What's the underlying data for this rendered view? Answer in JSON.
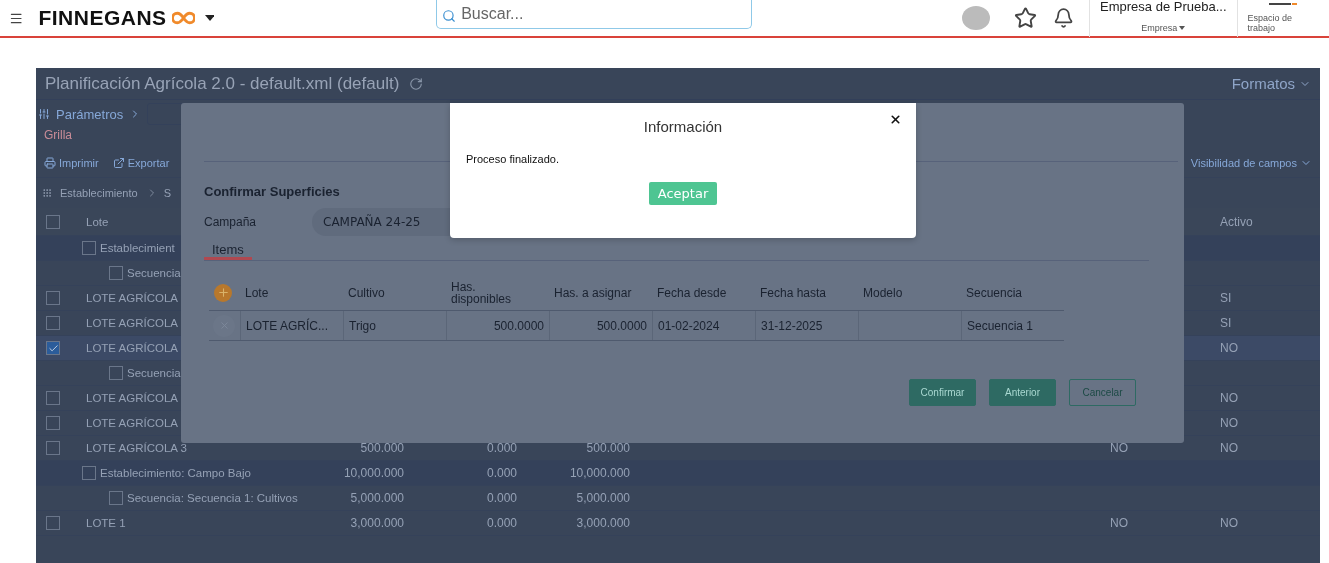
{
  "header": {
    "brand": "FINNEGANS",
    "search": {
      "placeholder": "Buscar..."
    },
    "company": {
      "name": "Empresa de Prueba...",
      "label": "Empresa"
    },
    "workspace": {
      "label": "Espacio de trabajo"
    }
  },
  "page": {
    "title": "Planificación Agrícola 2.0 - default.xml (default)",
    "formats": "Formatos",
    "params": "Parámetros",
    "section": "Grilla",
    "toolbar": [
      {
        "kind": "print",
        "label": "Imprimir"
      },
      {
        "kind": "export",
        "label": "Exportar"
      }
    ],
    "visibility": "Visibilidad de campos",
    "grouping": [
      "Establecimiento",
      "S"
    ]
  },
  "grid": {
    "select_all": false,
    "columns": [
      {
        "label": "Lote"
      },
      {
        "label": "Activo"
      }
    ],
    "rows": [
      {
        "kind": "group",
        "label": "Establecimient",
        "checked": false,
        "selected": false
      },
      {
        "kind": "sequence",
        "label": "Secuencia",
        "checked": false,
        "selected": false
      },
      {
        "kind": "lot",
        "label": "LOTE AGRÍCOLA",
        "checked": false,
        "selected": false,
        "active": "SI"
      },
      {
        "kind": "lot",
        "label": "LOTE AGRÍCOLA",
        "checked": false,
        "selected": false,
        "active": "SI"
      },
      {
        "kind": "lot",
        "label": "LOTE AGRÍCOLA",
        "checked": true,
        "selected": true,
        "active": "NO"
      },
      {
        "kind": "sequence",
        "label": "Secuencia",
        "checked": false,
        "selected": false
      },
      {
        "kind": "lot",
        "label": "LOTE AGRÍCOLA",
        "checked": false,
        "selected": false,
        "active": "NO"
      },
      {
        "kind": "lot",
        "label": "LOTE AGRÍCOLA",
        "checked": false,
        "selected": false,
        "active": "NO"
      },
      {
        "kind": "lot",
        "label": "LOTE AGRÍCOLA 3",
        "checked": false,
        "selected": false,
        "values": [
          "500.000",
          "0.000",
          "500.000"
        ],
        "column_7": "NO",
        "active": "NO"
      },
      {
        "kind": "group",
        "label": "Establecimiento: Campo Bajo",
        "checked": false,
        "selected": false,
        "values": [
          "10,000.000",
          "0.000",
          "10,000.000"
        ]
      },
      {
        "kind": "sequence",
        "label": "Secuencia: Secuencia 1: Cultivos",
        "checked": false,
        "selected": false,
        "values": [
          "5,000.000",
          "0.000",
          "5,000.000"
        ]
      },
      {
        "kind": "lot",
        "label": "LOTE 1",
        "checked": false,
        "selected": false,
        "values": [
          "3,000.000",
          "0.000",
          "3,000.000"
        ],
        "column_7": "NO",
        "active": "NO"
      }
    ]
  },
  "modal": {
    "title": "Confirmar Superficies",
    "campaign_label": "Campaña",
    "campaign": "CAMPAÑA 24-25",
    "tabs": [
      {
        "label": "Items",
        "selected": true
      }
    ],
    "columns": [
      "Lote",
      "Cultivo",
      "Has. disponibles",
      "Has. a asignar",
      "Fecha desde",
      "Fecha hasta",
      "Modelo",
      "Secuencia"
    ],
    "rows": [
      [
        "LOTE AGRÍC...",
        "Trigo",
        "500.0000",
        "500.0000",
        "01-02-2024",
        "31-12-2025",
        "",
        "Secuencia 1"
      ]
    ],
    "buttons": [
      {
        "kind": "solid",
        "label": "Confirmar"
      },
      {
        "kind": "solid",
        "label": "Anterior"
      },
      {
        "kind": "outline",
        "label": "Cancelar"
      }
    ]
  },
  "dialog": {
    "title": "Información",
    "message": "Proceso finalizado.",
    "button": "Aceptar"
  }
}
